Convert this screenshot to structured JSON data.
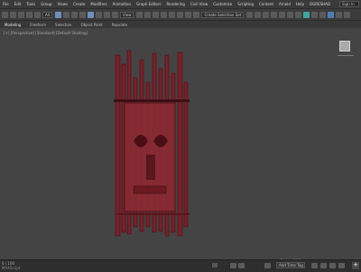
{
  "menubar": {
    "items": [
      "File",
      "Edit",
      "Tools",
      "Group",
      "Views",
      "Create",
      "Modifiers",
      "Animation",
      "Graph Editors",
      "Rendering",
      "Civil View",
      "Customize",
      "Scripting",
      "Content",
      "Arnold",
      "Help",
      "OGRESHAD"
    ],
    "search": "Sign In"
  },
  "toolbar": {
    "filter_dropdown": "All",
    "view_dropdown": "View",
    "selection_set_dropdown": "Create Selection Set"
  },
  "ribbon": {
    "tabs": [
      "Modeling",
      "Freeform",
      "Selection",
      "Object Paint",
      "Populate"
    ]
  },
  "statusbar": {
    "line1": "0 / 100",
    "line2": "MAXScript",
    "grid": "Grid = 10.0mm",
    "autokey_label": "Add Time Tag"
  },
  "viewport": {
    "label": "[+] [Perspective] [Standard] [Default Shading]"
  },
  "colors": {
    "object_red": "#7a1f28",
    "object_dark": "#3d0f14"
  }
}
